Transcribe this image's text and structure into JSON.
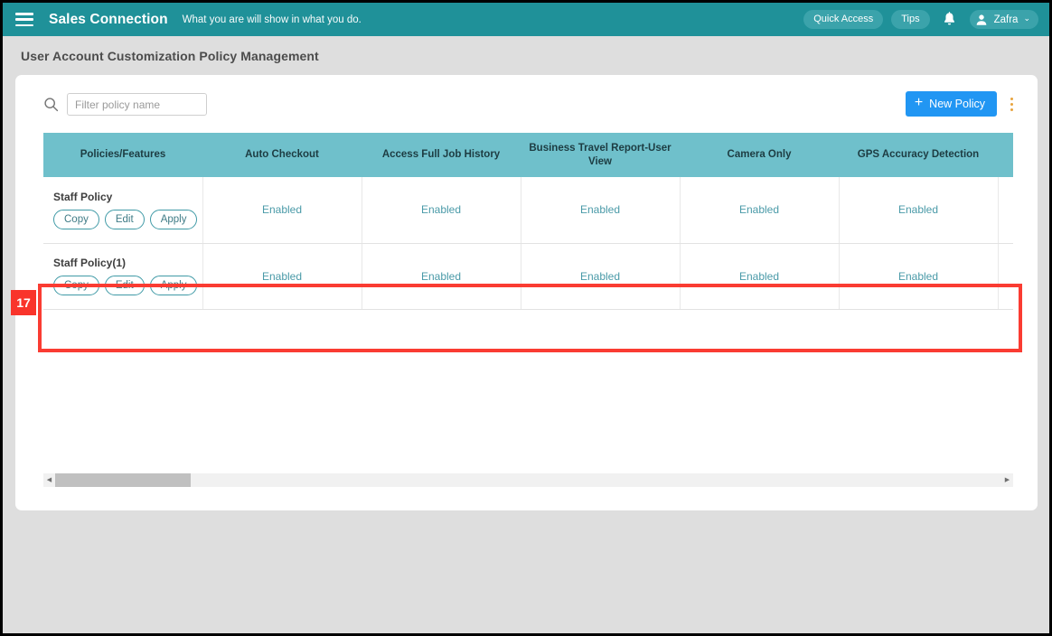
{
  "appbar": {
    "menu_icon": "hamburger-icon",
    "brand": "Sales Connection",
    "tagline": "What you are will show in what you do.",
    "quick_access_label": "Quick Access",
    "tips_label": "Tips",
    "bell_icon": "bell-icon",
    "user_name": "Zafra",
    "user_caret": "⌄",
    "bg_color": "#1f9199"
  },
  "page": {
    "title": "User Account Customization Policy Management",
    "bg_color": "#dedede"
  },
  "toolbar": {
    "search_icon": "search-icon",
    "search_value": "",
    "search_placeholder": "Filter policy name",
    "new_policy_label": "New Policy",
    "new_policy_plus": "+",
    "new_policy_color": "#2196f3",
    "kebab_icon": "more-vertical-icon"
  },
  "table": {
    "header_bg": "#6fc0cb",
    "columns": [
      "Policies/Features",
      "Auto Checkout",
      "Access Full Job History",
      "Business Travel Report-User View",
      "Camera Only",
      "GPS Accuracy Detection",
      ""
    ],
    "rows": [
      {
        "name": "Staff Policy",
        "actions": [
          "Copy",
          "Edit",
          "Apply"
        ],
        "values": [
          "Enabled",
          "Enabled",
          "Enabled",
          "Enabled",
          "Enabled",
          ""
        ]
      },
      {
        "name": "Staff Policy(1)",
        "actions": [
          "Copy",
          "Edit",
          "Apply"
        ],
        "values": [
          "Enabled",
          "Enabled",
          "Enabled",
          "Enabled",
          "Enabled",
          ""
        ]
      }
    ],
    "value_color": "#4a9aa8"
  },
  "highlight": {
    "badge": "17",
    "color": "#f9342b"
  },
  "scrollbar": {
    "left_arrow": "◀",
    "right_arrow": "▶"
  }
}
